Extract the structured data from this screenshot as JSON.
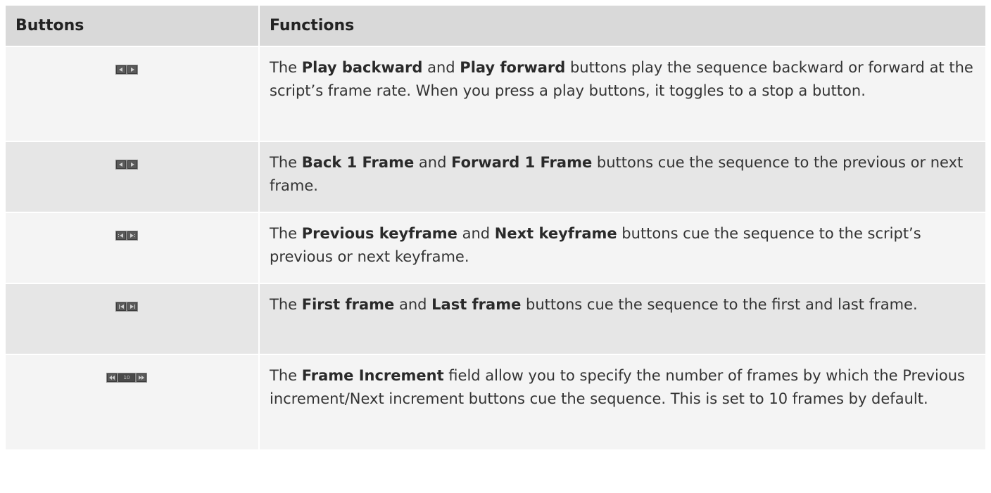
{
  "header": {
    "col1": "Buttons",
    "col2": "Functions"
  },
  "rows": [
    {
      "icon": "play-backward-forward-icon",
      "t1": "The ",
      "b1": "Play backward",
      "t2": " and ",
      "b2": "Play forward",
      "t3": " buttons play the sequence backward or forward at the script’s frame rate. When you press a play buttons, it toggles to a stop a button."
    },
    {
      "icon": "back-forward-1-frame-icon",
      "t1": "The ",
      "b1": "Back 1 Frame",
      "t2": " and ",
      "b2": "Forward 1 Frame",
      "t3": " buttons cue the sequence to the previous or next frame."
    },
    {
      "icon": "previous-next-keyframe-icon",
      "t1": "The ",
      "b1": "Previous keyframe",
      "t2": " and ",
      "b2": "Next keyframe",
      "t3": " buttons cue the sequence to the script’s previous or next keyframe."
    },
    {
      "icon": "first-last-frame-icon",
      "t1": "The ",
      "b1": "First frame",
      "t2": " and ",
      "b2": "Last frame",
      "t3": " buttons cue the sequence to the first and last frame."
    },
    {
      "icon": "frame-increment-icon",
      "increment_value": "10",
      "t1": "The ",
      "b1": "Frame Increment",
      "t2": " field allow you to specify the number of frames by which the Previous increment/Next increment buttons cue the sequence. This is set to 10 frames by default."
    }
  ]
}
